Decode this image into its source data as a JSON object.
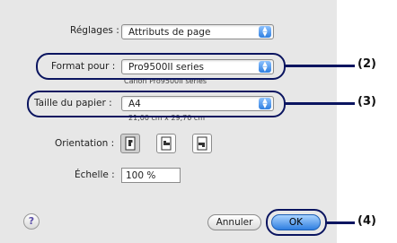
{
  "settings": {
    "label": "Réglages :",
    "value": "Attributs de page"
  },
  "format": {
    "label": "Format pour :",
    "value": "Pro9500II series",
    "subtitle": "Canon Pro9500II series"
  },
  "paper_size": {
    "label": "Taille du papier :",
    "value": "A4",
    "dimensions": "21,00 cm x 29,70 cm"
  },
  "orientation": {
    "label": "Orientation :"
  },
  "scale": {
    "label": "Échelle :",
    "value": "100 %"
  },
  "buttons": {
    "help": "?",
    "cancel": "Annuler",
    "ok": "OK"
  },
  "callouts": {
    "format": "(2)",
    "paper": "(3)",
    "ok": "(4)"
  },
  "colors": {
    "callout": "#0b1560",
    "accent": "#2f7fe0"
  }
}
